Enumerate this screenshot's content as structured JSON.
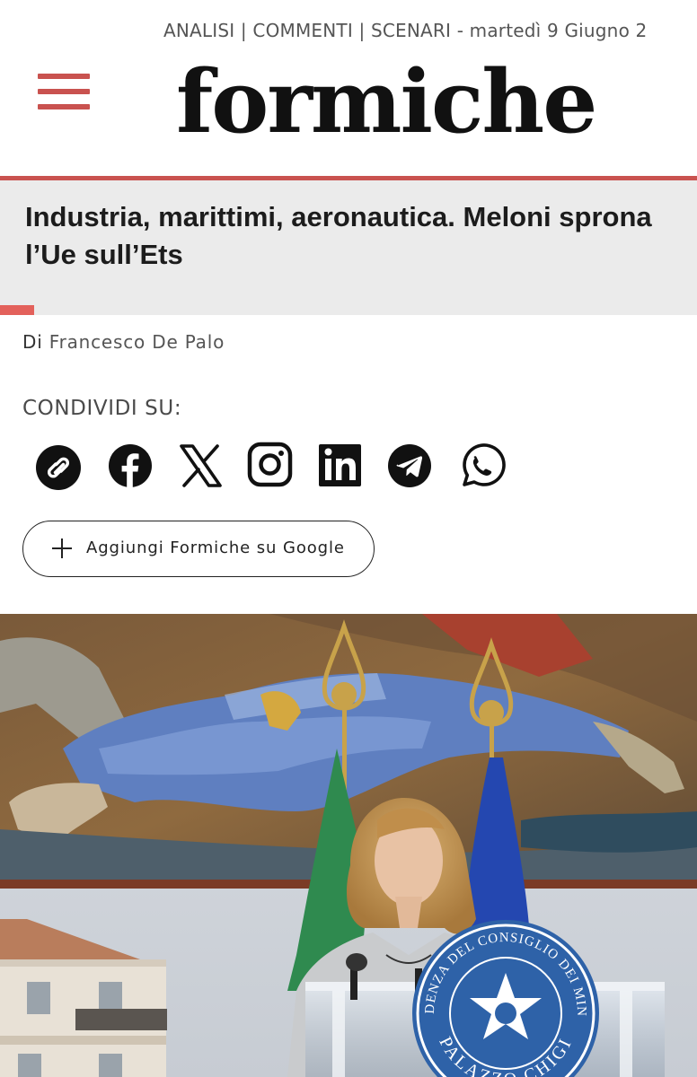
{
  "topnav": {
    "text": "ANALISI | COMMENTI | SCENARI - martedì 9 Giugno 2"
  },
  "header": {
    "logo": "formiche",
    "accent_color": "#c9524f"
  },
  "article": {
    "title": "Industria, marittimi, aeronautica. Meloni sprona l’Ue sull’Ets",
    "byline_prefix": "Di",
    "author": "Francesco De Palo"
  },
  "share": {
    "label": "CONDIVIDI SU:",
    "icons": [
      "link-icon",
      "facebook-icon",
      "x-icon",
      "instagram-icon",
      "linkedin-icon",
      "telegram-icon",
      "whatsapp-icon"
    ],
    "google_button_label": "Aggiungi Formiche su Google"
  },
  "hero": {
    "seal_text_top": "PRESIDENZA DEL CONSIGLIO DEI MINISTRI",
    "seal_text_bottom": "PALAZZO CHIGI"
  }
}
